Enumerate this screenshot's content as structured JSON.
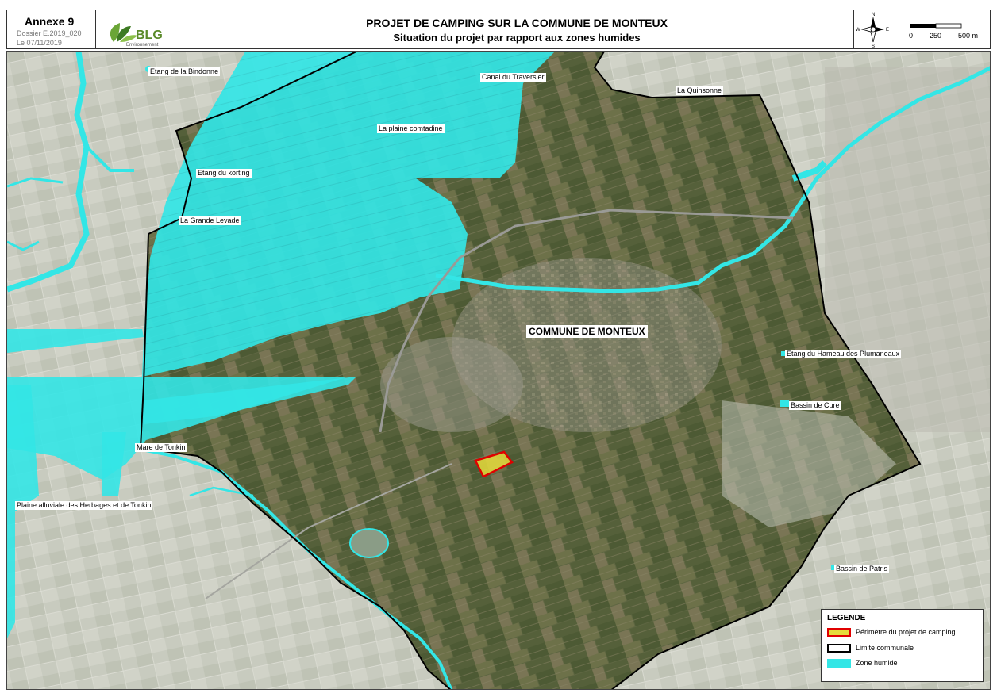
{
  "header": {
    "annexe": "Annexe 9",
    "dossier": "Dossier E.2019_020",
    "date": "Le 07/11/2019",
    "logo_text": "BLG",
    "logo_subtext": "Environnement",
    "title": "PROJET DE CAMPING SUR LA COMMUNE DE MONTEUX",
    "subtitle": "Situation du projet par rapport aux zones humides"
  },
  "compass": {
    "n": "N",
    "s": "S",
    "e": "E",
    "w": "W"
  },
  "scale": {
    "labels": [
      "0",
      "250",
      "500 m"
    ]
  },
  "map": {
    "commune_label": "COMMUNE DE MONTEUX",
    "labels": [
      "Etang de la Bindonne",
      "Canal du Traversier",
      "La Quinsonne",
      "La plaine comtadine",
      "Etang du korting",
      "La Grande Levade",
      "Etang du Hameau des Plumaneaux",
      "Bassin de Cure",
      "Mare de Tonkin",
      "Plaine alluviale des Herbages et de Tonkin",
      "Bassin de Patris"
    ]
  },
  "legend": {
    "title": "LEGENDE",
    "items": [
      {
        "label": "Périmètre du projet de camping",
        "fill": "#e6dc3c",
        "stroke": "#e00000"
      },
      {
        "label": "Limite communale",
        "fill": "#ffffff",
        "stroke": "#000000"
      },
      {
        "label": "Zone humide",
        "fill": "#33e6e6",
        "stroke": "#33e6e6"
      }
    ]
  },
  "colors": {
    "wetland": "#33e6e6",
    "commune_limit": "#000000",
    "project_outline": "#e00000",
    "project_fill": "#e6dc3c",
    "imagery_dark": "#5d6440",
    "imagery_light": "#c9cbbf"
  }
}
